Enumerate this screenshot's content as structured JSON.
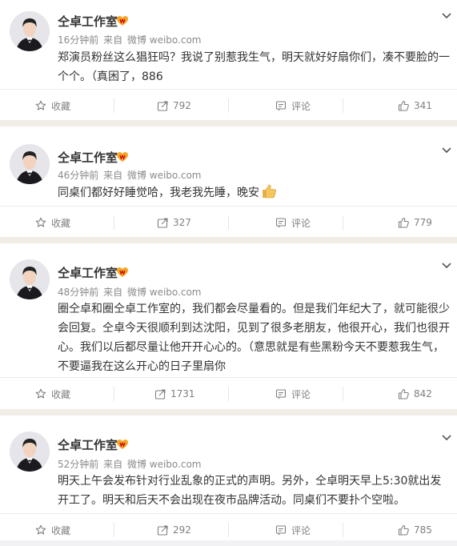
{
  "posts": [
    {
      "author": "仝卓工作室",
      "time": "16分钟前",
      "source_prefix": "来自",
      "source": "微博 weibo.com",
      "content": "郑演员粉丝这么猖狂吗？我说了别惹我生气，明天就好好扇你们，凑不要脸的一个个。（真困了，886",
      "favorite_label": "收藏",
      "repost_count": "792",
      "comment_label": "评论",
      "like_count": "341"
    },
    {
      "author": "仝卓工作室",
      "time": "46分钟前",
      "source_prefix": "来自",
      "source": "微博 weibo.com",
      "content": "同桌们都好好睡觉哈，我老我先睡，晚安",
      "favorite_label": "收藏",
      "repost_count": "327",
      "comment_label": "评论",
      "like_count": "779"
    },
    {
      "author": "仝卓工作室",
      "time": "48分钟前",
      "source_prefix": "来自",
      "source": "微博 weibo.com",
      "content": "圈仝卓和圈仝卓工作室的，我们都会尽量看的。但是我们年纪大了，就可能很少会回复。仝卓今天很顺利到达沈阳，见到了很多老朋友，他很开心，我们也很开心。我们以后都尽量让他开开心心的。（意思就是有些黑粉今天不要惹我生气，不要逼我在这么开心的日子里扇你",
      "favorite_label": "收藏",
      "repost_count": "1731",
      "comment_label": "评论",
      "like_count": "842"
    },
    {
      "author": "仝卓工作室",
      "time": "52分钟前",
      "source_prefix": "来自",
      "source": "微博 weibo.com",
      "content": "明天上午会发布针对行业乱象的正式的声明。另外，仝卓明天早上5:30就出发开工了。明天和后天不会出现在夜市品牌活动。同桌们不要扑个空啦。",
      "favorite_label": "收藏",
      "repost_count": "292",
      "comment_label": "评论",
      "like_count": "785"
    }
  ],
  "icons": {
    "avatar": "avatar-portrait",
    "vip_badge": "vip-badge-icon",
    "menu": "chevron-down-icon",
    "favorite": "star-icon",
    "repost": "repost-icon",
    "comment": "comment-icon",
    "like": "thumbs-up-icon",
    "emoji": "thumbs-up-emoji"
  },
  "colors": {
    "page_bg": "#f2f2f5",
    "divider": "#f0ede6",
    "text": "#333333",
    "meta": "#8a8a8a",
    "action": "#808080",
    "vip_badge": "#f5a623"
  }
}
